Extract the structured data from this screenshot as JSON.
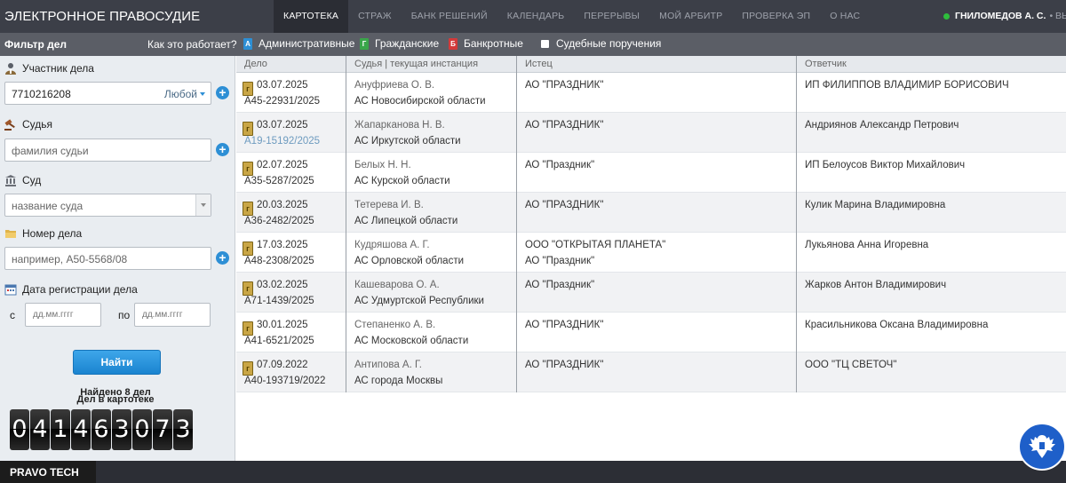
{
  "header": {
    "brand": "ЭЛЕКТРОННОЕ ПРАВОСУДИЕ",
    "nav": [
      "КАРТОТЕКА",
      "СТРАЖ",
      "БАНК РЕШЕНИЙ",
      "КАЛЕНДАРЬ",
      "ПЕРЕРЫВЫ",
      "МОЙ АРБИТР",
      "ПРОВЕРКА ЭП",
      "О НАС"
    ],
    "active_nav": "КАРТОТЕКА",
    "user": "ГНИЛОМЕДОВ А. С.",
    "logout": "• ВЫЙ"
  },
  "filterbar": {
    "title": "Фильтр дел",
    "how": "Как это работает?",
    "types": [
      {
        "label": "Административные",
        "letter": "А",
        "color": "#2d8fd5"
      },
      {
        "label": "Гражданские",
        "letter": "Г",
        "color": "#3aa64a"
      },
      {
        "label": "Банкротные",
        "letter": "Б",
        "color": "#d33a3a"
      },
      {
        "label": "Судебные поручения",
        "letter": "",
        "color": "#ffffff"
      }
    ]
  },
  "sidebar": {
    "participant_label": "Участник дела",
    "participant_value": "7710216208",
    "participant_role": "Любой",
    "judge_label": "Судья",
    "judge_placeholder": "фамилия судьи",
    "court_label": "Суд",
    "court_placeholder": "название суда",
    "case_label": "Номер дела",
    "case_placeholder": "например, А50-5568/08",
    "date_label": "Дата регистрации дела",
    "date_from": "с",
    "date_to": "по",
    "date_placeholder": "дд.мм.гггг",
    "find_button": "Найти",
    "found_text": "Найдено 8 дел",
    "in_card_index": "Дел в картотеке",
    "counter": [
      "0",
      "4",
      "1",
      "4",
      "6",
      "3",
      "0",
      "7",
      "3"
    ]
  },
  "table": {
    "columns": [
      "Дело",
      "Судья | текущая инстанция",
      "Истец",
      "Ответчик"
    ],
    "rows": [
      {
        "date": "03.07.2025",
        "number": "А45-22931/2025",
        "judge": "Ануфриева О. В.",
        "court": "АС Новосибирской области",
        "plaintiff": "АО \"ПРАЗДНИК\"",
        "plaintiff2": "",
        "defendant": "ИП ФИЛИППОВ ВЛАДИМИР БОРИСОВИЧ"
      },
      {
        "date": "03.07.2025",
        "number": "А19-15192/2025",
        "judge": "Жапарканова Н. В.",
        "court": "АС Иркутской области",
        "plaintiff": "АО \"ПРАЗДНИК\"",
        "plaintiff2": "",
        "defendant": "Андриянов Александр Петрович"
      },
      {
        "date": "02.07.2025",
        "number": "А35-5287/2025",
        "judge": "Белых Н. Н.",
        "court": "АС Курской области",
        "plaintiff": "АО \"Праздник\"",
        "plaintiff2": "",
        "defendant": "ИП Белоусов Виктор Михайлович"
      },
      {
        "date": "20.03.2025",
        "number": "А36-2482/2025",
        "judge": "Тетерева И. В.",
        "court": "АС Липецкой области",
        "plaintiff": "АО \"ПРАЗДНИК\"",
        "plaintiff2": "",
        "defendant": "Кулик Марина Владимировна"
      },
      {
        "date": "17.03.2025",
        "number": "А48-2308/2025",
        "judge": "Кудряшова А. Г.",
        "court": "АС Орловской области",
        "plaintiff": "ООО \"ОТКРЫТАЯ ПЛАНЕТА\"",
        "plaintiff2": "АО \"Праздник\"",
        "defendant": "Лукьянова Анна Игоревна"
      },
      {
        "date": "03.02.2025",
        "number": "А71-1439/2025",
        "judge": "Кашеварова О. А.",
        "court": "АС Удмуртской Республики",
        "plaintiff": "АО \"Праздник\"",
        "plaintiff2": "",
        "defendant": "Жарков Антон Владимирович"
      },
      {
        "date": "30.01.2025",
        "number": "А41-6521/2025",
        "judge": "Степаненко А. В.",
        "court": "АС Московской области",
        "plaintiff": "АО \"ПРАЗДНИК\"",
        "plaintiff2": "",
        "defendant": "Красильникова Оксана Владимировна"
      },
      {
        "date": "07.09.2022",
        "number": "А40-193719/2022",
        "judge": "Антипова А. Г.",
        "court": "АС города Москвы",
        "plaintiff": "АО \"ПРАЗДНИК\"",
        "plaintiff2": "",
        "defendant": "ООО \"ТЦ СВЕТОЧ\""
      }
    ]
  },
  "footer": {
    "brand": "PRAVO TECH"
  }
}
